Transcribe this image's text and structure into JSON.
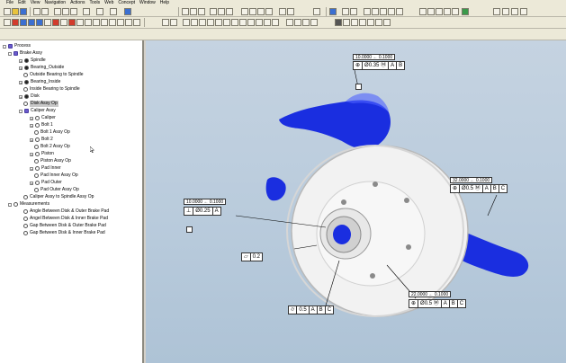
{
  "menu": [
    "File",
    "Edit",
    "View",
    "Navigation",
    "Actions",
    "Tools",
    "Web",
    "Concept",
    "Window",
    "Help"
  ],
  "tree": [
    {
      "label": "Process",
      "depth": 0
    },
    {
      "label": "Brake Assy",
      "depth": 1
    },
    {
      "label": "Spindle",
      "depth": 2
    },
    {
      "label": "Bearing_Outside",
      "depth": 2
    },
    {
      "label": "Outside Bearing to Spindle",
      "depth": 2
    },
    {
      "label": "Bearing_Inside",
      "depth": 2
    },
    {
      "label": "Inside Bearing to Spindle",
      "depth": 2
    },
    {
      "label": "Disk",
      "depth": 2
    },
    {
      "label": "Disk Assy Op",
      "depth": 2,
      "selected": true
    },
    {
      "label": "Caliper Assy",
      "depth": 2
    },
    {
      "label": "Caliper",
      "depth": 3
    },
    {
      "label": "Bolt 1",
      "depth": 3
    },
    {
      "label": "Bolt 1 Assy Op",
      "depth": 3
    },
    {
      "label": "Bolt 2",
      "depth": 3
    },
    {
      "label": "Bolt 2 Assy Op",
      "depth": 3
    },
    {
      "label": "Piston",
      "depth": 3
    },
    {
      "label": "Piston Assy Op",
      "depth": 3
    },
    {
      "label": "Pad Inner",
      "depth": 3
    },
    {
      "label": "Pad Inner Assy Op",
      "depth": 3
    },
    {
      "label": "Pad Outer",
      "depth": 3
    },
    {
      "label": "Pad Outer Assy Op",
      "depth": 3
    },
    {
      "label": "Caliper Assy to Spindle Assy Op",
      "depth": 2
    },
    {
      "label": "Measurements",
      "depth": 1
    },
    {
      "label": "Angle Between Disk & Outer Brake Pad",
      "depth": 2
    },
    {
      "label": "Angel Between Disk & Inner Brake Pad",
      "depth": 2
    },
    {
      "label": "Gap Between Disk & Outer Brake Pad",
      "depth": 2
    },
    {
      "label": "Gap Between Disk & Inner Brake Pad",
      "depth": 2
    }
  ],
  "annotations": {
    "a1": {
      "tol": "10.0000 ← 0.1000",
      "sym": "⊕",
      "dia": "Ø0.35",
      "mod": "Ⓜ",
      "d1": "A",
      "d2": "B"
    },
    "a2": {
      "tol": "32.0000 ← 0.1000",
      "sym": "⊕",
      "dia": "Ø0.5",
      "mod": "Ⓜ",
      "d1": "A",
      "d2": "B",
      "d3": "C"
    },
    "a3": {
      "tol": "10.0000 ← 0.1000",
      "sym": "⊥",
      "dia": "Ø0.25",
      "d1": "A"
    },
    "a4": {
      "sym": "▱",
      "val": "0.2"
    },
    "a5": {
      "sym": "⌭",
      "val": "0.5",
      "d1": "A",
      "d2": "B",
      "d3": "C"
    },
    "a6": {
      "tol": "22.0000 ← 0.1000",
      "sym": "⊕",
      "dia": "Ø0.5",
      "mod": "Ⓜ",
      "d1": "A",
      "d2": "B",
      "d3": "C"
    }
  },
  "colors": {
    "part_blue": "#1a2ee0",
    "disk": "#f2f2f2",
    "viewport": "#bccbdb"
  }
}
